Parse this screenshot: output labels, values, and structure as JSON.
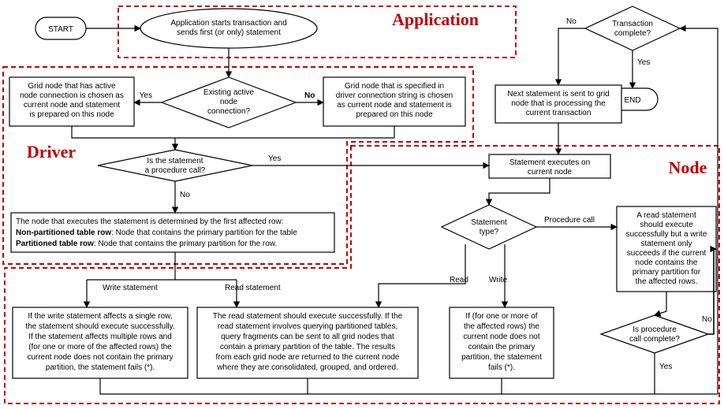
{
  "regions": {
    "application": {
      "label": "Application"
    },
    "driver": {
      "label": "Driver"
    },
    "node": {
      "label": "Node"
    }
  },
  "nodes": {
    "start": {
      "label": "START"
    },
    "end": {
      "label": "END"
    },
    "app_start": {
      "line1": "Application starts transaction and",
      "line2": "sends first (or only) statement"
    },
    "tx_complete": {
      "line1": "Transaction",
      "line2": "complete?"
    },
    "next_stmt": {
      "line1": "Next statement is sent to grid",
      "line2": "node that is processing the",
      "line3": "current transaction"
    },
    "active_conn": {
      "line1": "Existing active",
      "line2": "node",
      "line3": "connection?"
    },
    "grid_active": {
      "line1": "Grid node that has active",
      "line2": "node connection is chosen as",
      "line3": "current node and statement",
      "line4": "is prepared on this node"
    },
    "grid_conn_string": {
      "line1": "Grid node that is specified in",
      "line2": "driver connection string is chosen",
      "line3": "as current node and statement is",
      "line4": "prepared on this node"
    },
    "is_proc": {
      "line1": "Is the statement",
      "line2": "a procedure call?"
    },
    "exec_current": {
      "line1": "Statement executes on",
      "line2": "current node"
    },
    "first_row": {
      "text_full": "The node that executes the statement is determined by the first affected row:",
      "line2a": "Non-partitioned table row",
      "line2b": ": Node that contains the primary partition for the table",
      "line3a": "Partitioned table row",
      "line3b": ": Node that contains the primary partition for the row."
    },
    "stmt_type": {
      "line1": "Statement",
      "line2": "type?"
    },
    "read_proc_box": {
      "line1": "A read statement",
      "line2": "should execute",
      "line3": "successfully but a write",
      "line4": "statement only",
      "line5": "succeeds if the current",
      "line6": "node contains the",
      "line7": "primary partition for",
      "line8": "the affected rows."
    },
    "proc_complete": {
      "line1": "Is procedure",
      "line2": "call complete?"
    },
    "write_box": {
      "line1": "If the write statement affects a single row,",
      "line2": "the statement should execute successfully.",
      "line3": "If the statement affects multiple rows and",
      "line4": "(for one or more of the affected rows) the",
      "line5": "current node does not contain the primary",
      "line6": "partition, the statement fails (*)."
    },
    "read_box": {
      "line1": "The read statement should execute successfully.  If the",
      "line2": "read statement involves querying partitioned tables,",
      "line3": "query fragments can be sent to all grid nodes that",
      "line4": "contain a primary partition of the table. The results",
      "line5": "from each grid node are returned to the current node",
      "line6": "where they are consolidated, grouped, and ordered."
    },
    "fail_box": {
      "line1": "If (for one or more of",
      "line2": "the affected rows) the",
      "line3": "current node does not",
      "line4": "contain the primary",
      "line5": "partition, the statement",
      "line6": "fails (*)."
    }
  },
  "branch_labels": {
    "write_stmt": "Write statement",
    "read_stmt": "Read statement",
    "read": "Read",
    "write": "Write",
    "proc_call": "Procedure call",
    "yes": "Yes",
    "no": "No"
  },
  "colors": {
    "region_stroke": "#c00000",
    "region_text": "#c00000",
    "line": "#000000",
    "fill": "#ffffff"
  }
}
